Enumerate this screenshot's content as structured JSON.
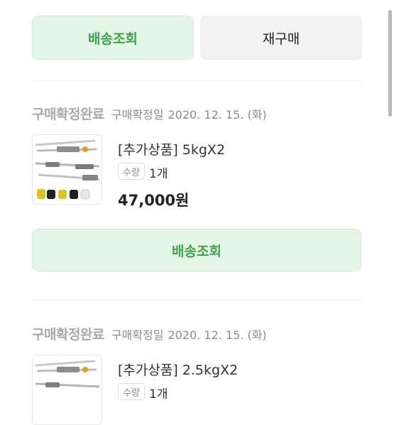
{
  "top_buttons": {
    "track": "배송조회",
    "reorder": "재구매"
  },
  "orders": [
    {
      "status": "구매확정완료",
      "date_label": "구매확정일",
      "date": "2020. 12. 15. (화)",
      "product_name": "[추가상품] 5kgX2",
      "qty_label": "수량",
      "qty": "1개",
      "price": "47,000원",
      "track_button": "배송조회"
    },
    {
      "status": "구매확정완료",
      "date_label": "구매확정일",
      "date": "2020. 12. 15. (화)",
      "product_name": "[추가상품] 2.5kgX2",
      "qty_label": "수량",
      "qty": "1개"
    }
  ],
  "colors": {
    "accent_green": "#3fa24b",
    "green_bg": "#e4f6e6"
  }
}
